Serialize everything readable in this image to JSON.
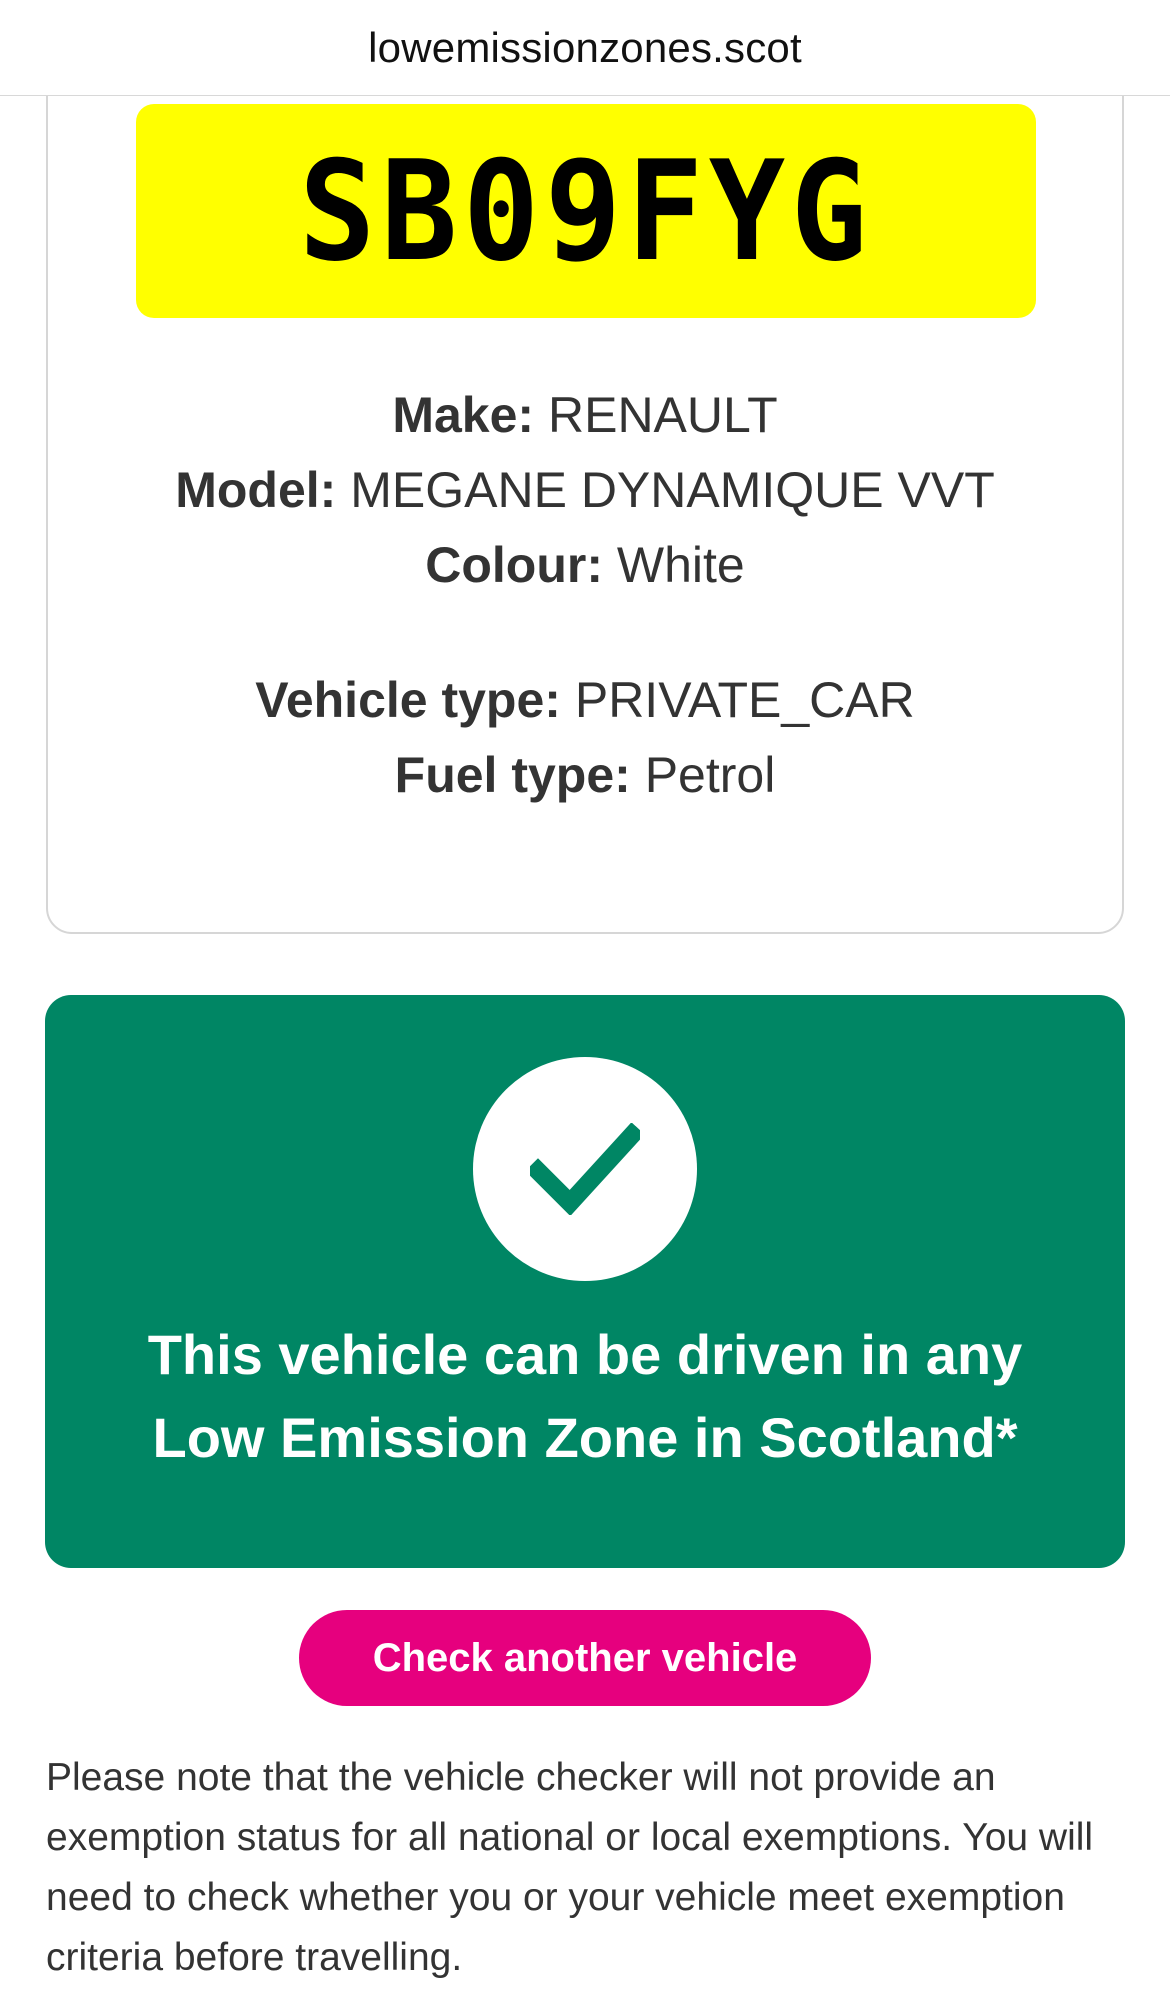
{
  "browser": {
    "url": "lowemissionzones.scot"
  },
  "vehicle": {
    "plate": "SB09FYG",
    "make_label": "Make:",
    "make": "RENAULT",
    "model_label": "Model:",
    "model": "MEGANE DYNAMIQUE VVT",
    "colour_label": "Colour:",
    "colour": "White",
    "vehicle_type_label": "Vehicle type:",
    "vehicle_type": "PRIVATE_CAR",
    "fuel_type_label": "Fuel type:",
    "fuel_type": "Petrol"
  },
  "result": {
    "icon": "checkmark-icon",
    "line1": "This vehicle can be driven in any",
    "line2": "Low Emission Zone in Scotland*"
  },
  "actions": {
    "check_another_label": "Check another vehicle"
  },
  "note": {
    "text": "Please note that the vehicle checker will not provide an exemption status for all national or local exemptions. You will need to check whether you or your vehicle meet exemption criteria before travelling."
  },
  "colors": {
    "plate_yellow": "#ffff00",
    "result_green": "#008664",
    "button_pink": "#e6007e",
    "text_dark": "#333333"
  }
}
